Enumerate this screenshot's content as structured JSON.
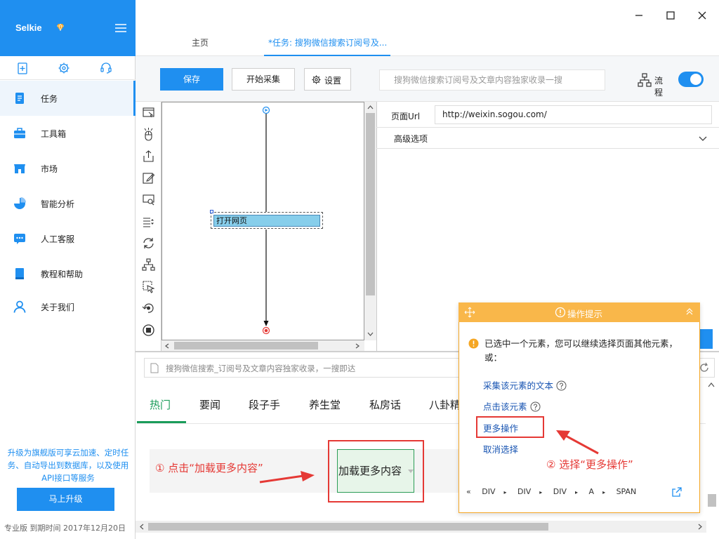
{
  "app": {
    "name": "Selkie",
    "version_text": "专业版 到期时间 2017年12月20日"
  },
  "sidebar": {
    "items": [
      {
        "label": "任务",
        "active": true,
        "icon": "document-icon"
      },
      {
        "label": "工具箱",
        "icon": "toolbox-icon"
      },
      {
        "label": "市场",
        "icon": "store-icon"
      },
      {
        "label": "智能分析",
        "icon": "pie-chart-icon"
      },
      {
        "label": "人工客服",
        "icon": "chat-icon"
      },
      {
        "label": "教程和帮助",
        "icon": "book-icon"
      },
      {
        "label": "关于我们",
        "icon": "user-icon"
      }
    ],
    "promo": "升级为旗舰版可享云加速、定时任务、自动导出到数据库，以及使用API接口等服务",
    "upgrade_label": "马上升级"
  },
  "tabs": [
    {
      "label": "主页"
    },
    {
      "label": "*任务: 搜狗微信搜索订阅号及..."
    }
  ],
  "toolbar": {
    "save_label": "保存",
    "start_label": "开始采集",
    "settings_label": "设置",
    "task_name": "搜狗微信搜索订阅号及文章内容独家收录一搜",
    "flow_label": "流程",
    "flow_enabled": true
  },
  "flow": {
    "node_label": "打开网页"
  },
  "props": {
    "url_label": "页面Url",
    "url_value": "http://weixin.sogou.com/",
    "advanced_label": "高级选项"
  },
  "browser": {
    "address": "搜狗微信搜索_订阅号及文章内容独家收录，一搜即达",
    "tabs": [
      "热门",
      "要闻",
      "段子手",
      "养生堂",
      "私房话",
      "八卦精"
    ],
    "load_more": "加载更多内容"
  },
  "annotations": {
    "step1": "① 点击“加载更多内容”",
    "step2": "② 选择“更多操作”"
  },
  "tip": {
    "title": "操作提示",
    "message": "已选中一个元素，您可以继续选择页面其他元素，或：",
    "links": [
      "采集该元素的文本",
      "点击该元素",
      "更多操作",
      "取消选择"
    ],
    "breadcrumb": [
      "DIV",
      "DIV",
      "DIV",
      "A",
      "SPAN"
    ]
  },
  "colors": {
    "accent": "#1f8ff0",
    "tip_header": "#f9b74a",
    "highlight": "#e53935",
    "green": "#1a9c5a"
  }
}
